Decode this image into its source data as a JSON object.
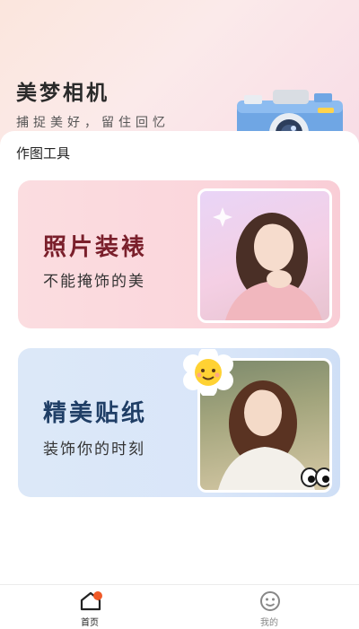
{
  "header": {
    "app_title": "美梦相机",
    "slogan": "捕捉美好，留住回忆"
  },
  "section": {
    "title": "作图工具"
  },
  "cards": [
    {
      "title": "照片装裱",
      "subtitle": "不能掩饰的美"
    },
    {
      "title": "精美贴纸",
      "subtitle": "装饰你的时刻"
    }
  ],
  "tabbar": {
    "items": [
      {
        "label": "首页",
        "icon": "home-icon",
        "active": true
      },
      {
        "label": "我的",
        "icon": "profile-face-icon",
        "active": false
      }
    ]
  },
  "colors": {
    "card1_title": "#7a1f2b",
    "card2_title": "#1f3e66",
    "accent": "#f05a28"
  }
}
